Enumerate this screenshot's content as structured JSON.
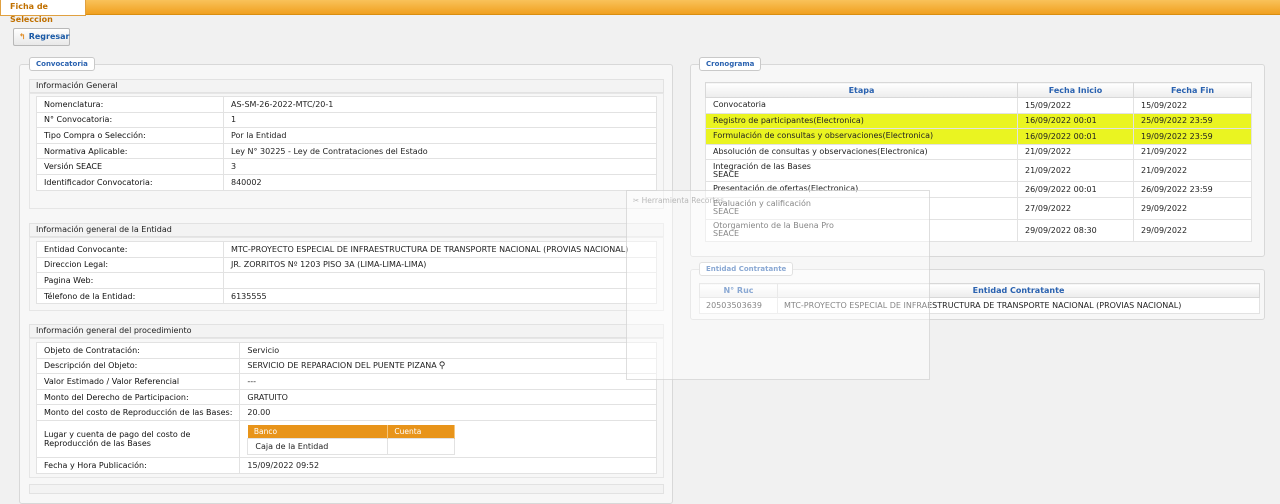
{
  "top_tab": "Ficha de Seleccion",
  "back_button": {
    "label": "Regresar",
    "icon": "back-arrow-icon"
  },
  "convocatoria": {
    "legend": "Convocatoria",
    "info_general": {
      "title": "Información General",
      "rows": [
        {
          "label": "Nomenclatura:",
          "value": "AS-SM-26-2022-MTC/20-1"
        },
        {
          "label": "N° Convocatoria:",
          "value": "1"
        },
        {
          "label": "Tipo Compra o Selección:",
          "value": "Por la Entidad"
        },
        {
          "label": "Normativa Aplicable:",
          "value": "Ley N° 30225 - Ley de Contrataciones del Estado"
        },
        {
          "label": "Versión SEACE",
          "value": "3"
        },
        {
          "label": "Identificador Convocatoria:",
          "value": "840002"
        }
      ]
    },
    "info_entidad": {
      "title": "Información general de la Entidad",
      "rows": [
        {
          "label": "Entidad Convocante:",
          "value": "MTC-PROYECTO ESPECIAL DE INFRAESTRUCTURA DE TRANSPORTE NACIONAL (PROVIAS NACIONAL)"
        },
        {
          "label": "Direccion Legal:",
          "value": "JR. ZORRITOS Nº 1203 PISO 3A (LIMA-LIMA-LIMA)"
        },
        {
          "label": "Pagina Web:",
          "value": ""
        },
        {
          "label": "Télefono de la Entidad:",
          "value": "6135555"
        }
      ]
    },
    "info_procedimiento": {
      "title": "Información general del procedimiento",
      "rows": [
        {
          "label": "Objeto de Contratación:",
          "value": "Servicio"
        },
        {
          "label": "Descripción del Objeto:",
          "value": "SERVICIO DE REPARACION DEL PUENTE PIZANA"
        },
        {
          "label": "Valor Estimado / Valor Referencial",
          "value": "---"
        },
        {
          "label": "Monto del Derecho de Participacion:",
          "value": "GRATUITO"
        },
        {
          "label": "Monto del costo de Reproducción de las Bases:",
          "value": "20.00"
        }
      ],
      "lugar_label": "Lugar y cuenta de pago del costo de Reproducción de las Bases",
      "bank_table": {
        "headers": [
          "Banco",
          "Cuenta"
        ],
        "rows": [
          [
            "Caja de la Entidad",
            ""
          ]
        ]
      },
      "fecha_label": "Fecha y Hora Publicación:",
      "fecha_value": "15/09/2022 09:52"
    }
  },
  "cronograma": {
    "legend": "Cronograma",
    "headers": [
      "Etapa",
      "Fecha Inicio",
      "Fecha Fin"
    ],
    "rows": [
      {
        "etapa": "Convocatoria",
        "etapa2": "",
        "inicio": "15/09/2022",
        "fin": "15/09/2022",
        "highlight": false
      },
      {
        "etapa": "Registro de participantes(Electronica)",
        "etapa2": "",
        "inicio": "16/09/2022 00:01",
        "fin": "25/09/2022 23:59",
        "highlight": true
      },
      {
        "etapa": "Formulación de consultas y observaciones(Electronica)",
        "etapa2": "",
        "inicio": "16/09/2022 00:01",
        "fin": "19/09/2022 23:59",
        "highlight": true
      },
      {
        "etapa": "Absolución de consultas y observaciones(Electronica)",
        "etapa2": "",
        "inicio": "21/09/2022",
        "fin": "21/09/2022",
        "highlight": false
      },
      {
        "etapa": "Integración de las Bases",
        "etapa2": "SEACE",
        "inicio": "21/09/2022",
        "fin": "21/09/2022",
        "highlight": false
      },
      {
        "etapa": "Presentación de ofertas(Electronica)",
        "etapa2": "",
        "inicio": "26/09/2022 00:01",
        "fin": "26/09/2022 23:59",
        "highlight": false
      },
      {
        "etapa": "Evaluación y calificación",
        "etapa2": "SEACE",
        "inicio": "27/09/2022",
        "fin": "29/09/2022",
        "highlight": false
      },
      {
        "etapa": "Otorgamiento de la Buena Pro",
        "etapa2": "SEACE",
        "inicio": "29/09/2022 08:30",
        "fin": "29/09/2022",
        "highlight": false
      }
    ],
    "highlight_color": "#eaf421"
  },
  "entidad_contratante": {
    "legend": "Entidad Contratante",
    "headers": [
      "N° Ruc",
      "Entidad Contratante"
    ],
    "rows": [
      [
        "20503503639",
        "MTC-PROYECTO ESPECIAL DE INFRAESTRUCTURA DE TRANSPORTE NACIONAL (PROVIAS NACIONAL)"
      ]
    ]
  },
  "overlay": {
    "title": "Herramienta Recortes"
  },
  "colors": {
    "accent": "#f0a020",
    "link": "#2a62b0",
    "bank_header": "#e8941a"
  }
}
